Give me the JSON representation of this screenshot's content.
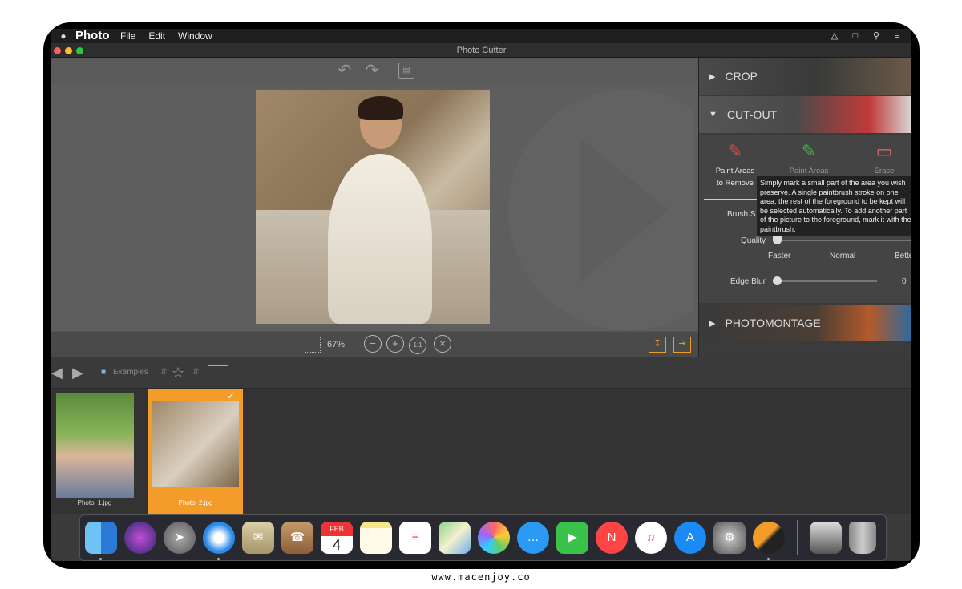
{
  "menubar": {
    "apple": "",
    "app_name": "Photo Cutter",
    "items": [
      "File",
      "Edit",
      "Window"
    ]
  },
  "window": {
    "title": "Photo Cutter"
  },
  "toolbar": {
    "undo_icon": "undo-icon",
    "redo_icon": "redo-icon",
    "save_icon": "save-icon"
  },
  "zoom": {
    "value": "67%",
    "actual_size_label": "1:1"
  },
  "panel": {
    "sections": {
      "crop": "CROP",
      "cutout": "CUT-OUT",
      "photomontage": "PHOTOMONTAGE"
    },
    "tools": [
      {
        "label1": "Paint Areas",
        "label2": "to Remove"
      },
      {
        "label1": "Paint Areas",
        "label2": ""
      },
      {
        "label1": "Erase",
        "label2": ""
      }
    ],
    "tooltip": "Simply mark a small part of the area you wish preserve. A single paintbrush stroke on one area, the rest of the foreground to be kept will be selected automatically. To add another part of the picture to the foreground, mark it with the paintbrush.",
    "brush_label": "Brush S",
    "quality_label": "Quality",
    "quality_ticks": [
      "Faster",
      "Normal",
      "Bette"
    ],
    "quality_level": 0,
    "edge_blur_label": "Edge Blur",
    "edge_blur_value": "0",
    "edge_blur_level": 0
  },
  "filmstrip": {
    "folder": "Examples"
  },
  "thumbnails": [
    {
      "caption": "Photo_1.jpg",
      "selected": false
    },
    {
      "caption": "Photo_2.jpg",
      "selected": true
    }
  ],
  "dock": {
    "apps": [
      "Finder",
      "Siri",
      "Launchpad",
      "Safari",
      "Mail",
      "Contacts",
      "Calendar",
      "Notes",
      "Reminders",
      "Maps",
      "Photos",
      "Messages",
      "FaceTime",
      "News",
      "Music",
      "App Store",
      "System Preferences",
      "Photo Cutter",
      "Downloads",
      "Trash"
    ],
    "calendar_month": "FEB",
    "calendar_day": "4"
  },
  "colors": {
    "accent": "#f39c2a",
    "panel": "#3b3b3b"
  },
  "watermark": "www.macenjoy.co"
}
